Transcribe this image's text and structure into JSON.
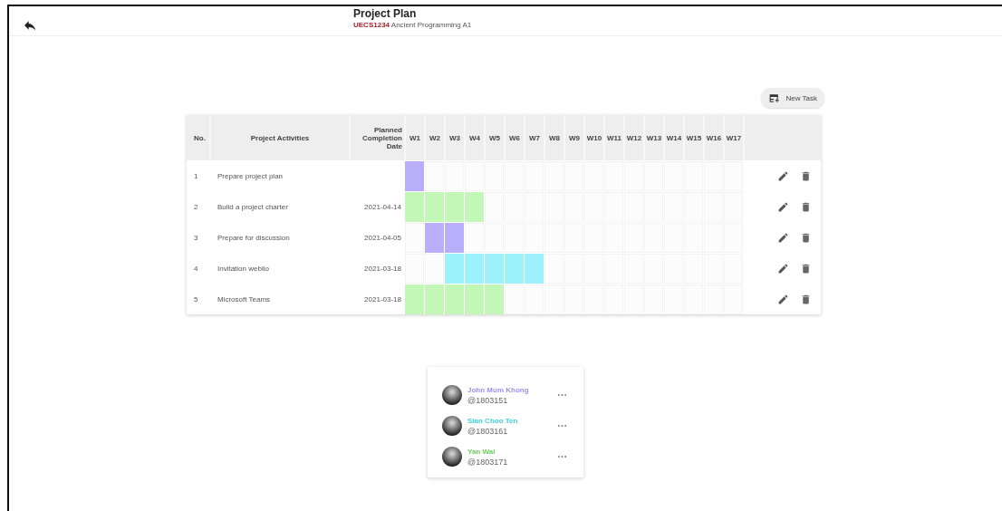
{
  "header": {
    "title": "Project Plan",
    "course_code": "UECS1234",
    "course_name": "Ancient Programming A1"
  },
  "new_task_button": {
    "label": "New Task"
  },
  "table": {
    "columns": [
      "No.",
      "Project Activities",
      "Planned Completion Date"
    ],
    "weeks": [
      "W1",
      "W2",
      "W3",
      "W4",
      "W5",
      "W6",
      "W7",
      "W8",
      "W9",
      "W10",
      "W11",
      "W12",
      "W13",
      "W14",
      "W15",
      "W16",
      "W17"
    ],
    "rows": [
      {
        "no": "1",
        "activity": "Prepare project plan",
        "date": "",
        "color": "#b9aefa",
        "filled": [
          true,
          false,
          false,
          false,
          false,
          false,
          false,
          false,
          false,
          false,
          false,
          false,
          false,
          false,
          false,
          false,
          false
        ]
      },
      {
        "no": "2",
        "activity": "Build a project charter",
        "date": "2021-04-14",
        "color": "#c3f7b8",
        "filled": [
          true,
          true,
          true,
          true,
          false,
          false,
          false,
          false,
          false,
          false,
          false,
          false,
          false,
          false,
          false,
          false,
          false
        ]
      },
      {
        "no": "3",
        "activity": "Prepare for discussion",
        "date": "2021-04-05",
        "color": "#b9aefa",
        "filled": [
          false,
          true,
          true,
          false,
          false,
          false,
          false,
          false,
          false,
          false,
          false,
          false,
          false,
          false,
          false,
          false,
          false
        ]
      },
      {
        "no": "4",
        "activity": "Invitation weblio",
        "date": "2021-03-18",
        "color": "#9df1fb",
        "filled": [
          false,
          false,
          true,
          true,
          true,
          true,
          true,
          false,
          false,
          false,
          false,
          false,
          false,
          false,
          false,
          false,
          false
        ]
      },
      {
        "no": "5",
        "activity": "Microsoft Teams",
        "date": "2021-03-18",
        "color": "#c3f7b8",
        "filled": [
          true,
          true,
          true,
          true,
          true,
          false,
          false,
          false,
          false,
          false,
          false,
          false,
          false,
          false,
          false,
          false,
          false
        ]
      }
    ]
  },
  "members": [
    {
      "name": "John Mum Khong",
      "handle": "@1803151",
      "color": "#9d8ff2"
    },
    {
      "name": "Sian Choo Ten",
      "handle": "@1803161",
      "color": "#3fcfe3"
    },
    {
      "name": "Yan Wai",
      "handle": "@1803171",
      "color": "#6fcf5c"
    }
  ]
}
